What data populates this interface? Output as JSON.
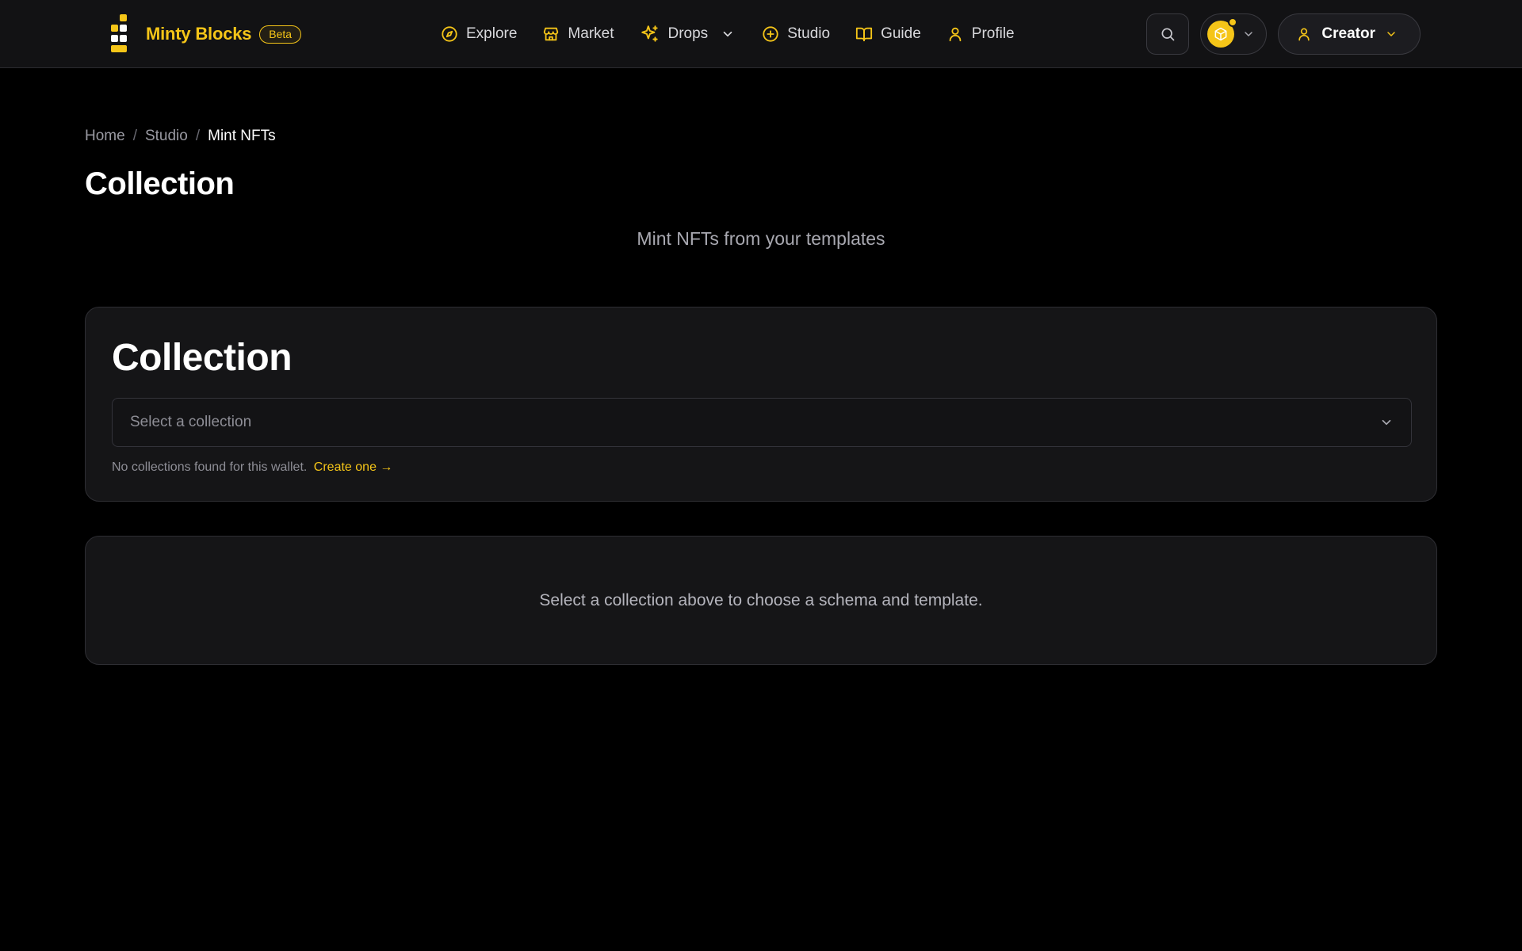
{
  "brand": {
    "name": "Minty Blocks",
    "badge": "Beta",
    "accent_color": "#f5c518"
  },
  "nav": {
    "items": [
      {
        "label": "Explore",
        "icon": "compass-icon"
      },
      {
        "label": "Market",
        "icon": "store-icon"
      },
      {
        "label": "Drops",
        "icon": "sparkles-icon",
        "dropdown": true
      },
      {
        "label": "Studio",
        "icon": "plus-circle-icon"
      },
      {
        "label": "Guide",
        "icon": "book-icon"
      },
      {
        "label": "Profile",
        "icon": "user-icon"
      }
    ]
  },
  "header_actions": {
    "search_icon": "search-icon",
    "wallet_icon": "cube-coin-icon",
    "creator_label": "Creator"
  },
  "breadcrumb": {
    "items": [
      "Home",
      "Studio",
      "Mint NFTs"
    ],
    "separator": "/"
  },
  "page": {
    "title": "Collection",
    "subtitle": "Mint NFTs from your templates"
  },
  "collection_card": {
    "heading": "Collection",
    "select_placeholder": "Select a collection",
    "hint_text": "No collections found for this wallet.",
    "hint_link": "Create one →"
  },
  "placeholder_card": {
    "message": "Select a collection above to choose a schema and template."
  }
}
